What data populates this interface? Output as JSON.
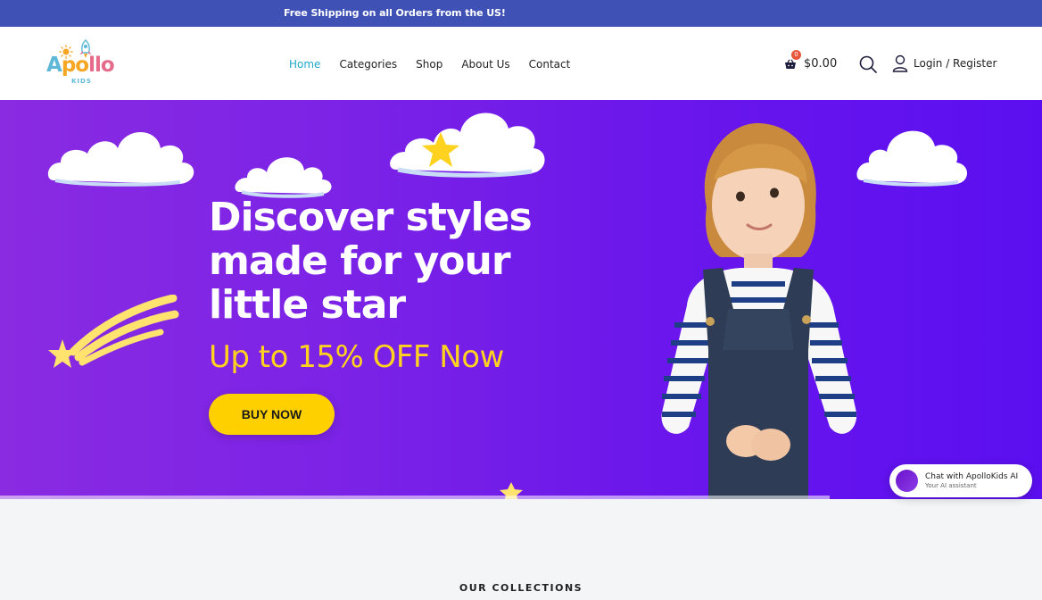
{
  "announcement": {
    "text": "Free Shipping on all Orders from the US!"
  },
  "logo": {
    "word_a": "A",
    "word_b": "po",
    "word_c": "llo",
    "sub": "KIDS"
  },
  "nav": {
    "items": [
      {
        "label": "Home",
        "active": true
      },
      {
        "label": "Categories",
        "active": false
      },
      {
        "label": "Shop",
        "active": false
      },
      {
        "label": "About Us",
        "active": false
      },
      {
        "label": "Contact",
        "active": false
      }
    ]
  },
  "header": {
    "cart_count": "0",
    "cart_total": "$0.00",
    "login_label": "Login / Register",
    "icons": {
      "cart": "basket-icon",
      "search": "search-icon",
      "user": "user-icon"
    }
  },
  "hero": {
    "headline": [
      "Discover styles",
      "made for your",
      "little star"
    ],
    "offer": "Up to 15% OFF Now",
    "cta": "BUY NOW"
  },
  "chat": {
    "title": "Chat with ApolloKids AI",
    "subtitle": "Your AI assistant"
  },
  "section": {
    "title": "OUR COLLECTIONS"
  },
  "colors": {
    "topbar": "#3f51b5",
    "nav_active": "#1fa8c9",
    "hero_start": "#8a2be2",
    "hero_end": "#5b0ff0",
    "offer": "#ffd21f",
    "cta": "#ffd000"
  }
}
